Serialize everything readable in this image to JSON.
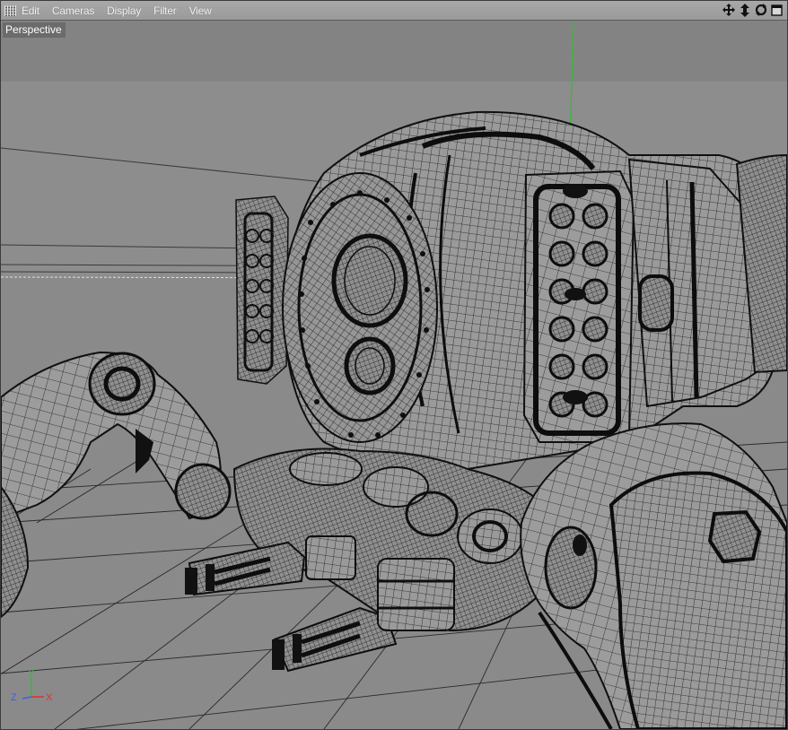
{
  "menubar": {
    "items": [
      "Edit",
      "Cameras",
      "Display",
      "Filter",
      "View"
    ],
    "nav_icons": [
      "move-view-icon",
      "dolly-view-icon",
      "rotate-view-icon",
      "maximize-view-icon"
    ]
  },
  "viewport": {
    "label": "Perspective",
    "axis": {
      "x": "X",
      "y": "Y",
      "z": "Z"
    }
  },
  "colors": {
    "menubar": "#a3a3a3",
    "viewport_bg": "#8c8c8c",
    "wire": "#1a1a1a",
    "axis_x": "#e03030",
    "axis_y": "#30c030",
    "axis_z": "#4060e0"
  }
}
